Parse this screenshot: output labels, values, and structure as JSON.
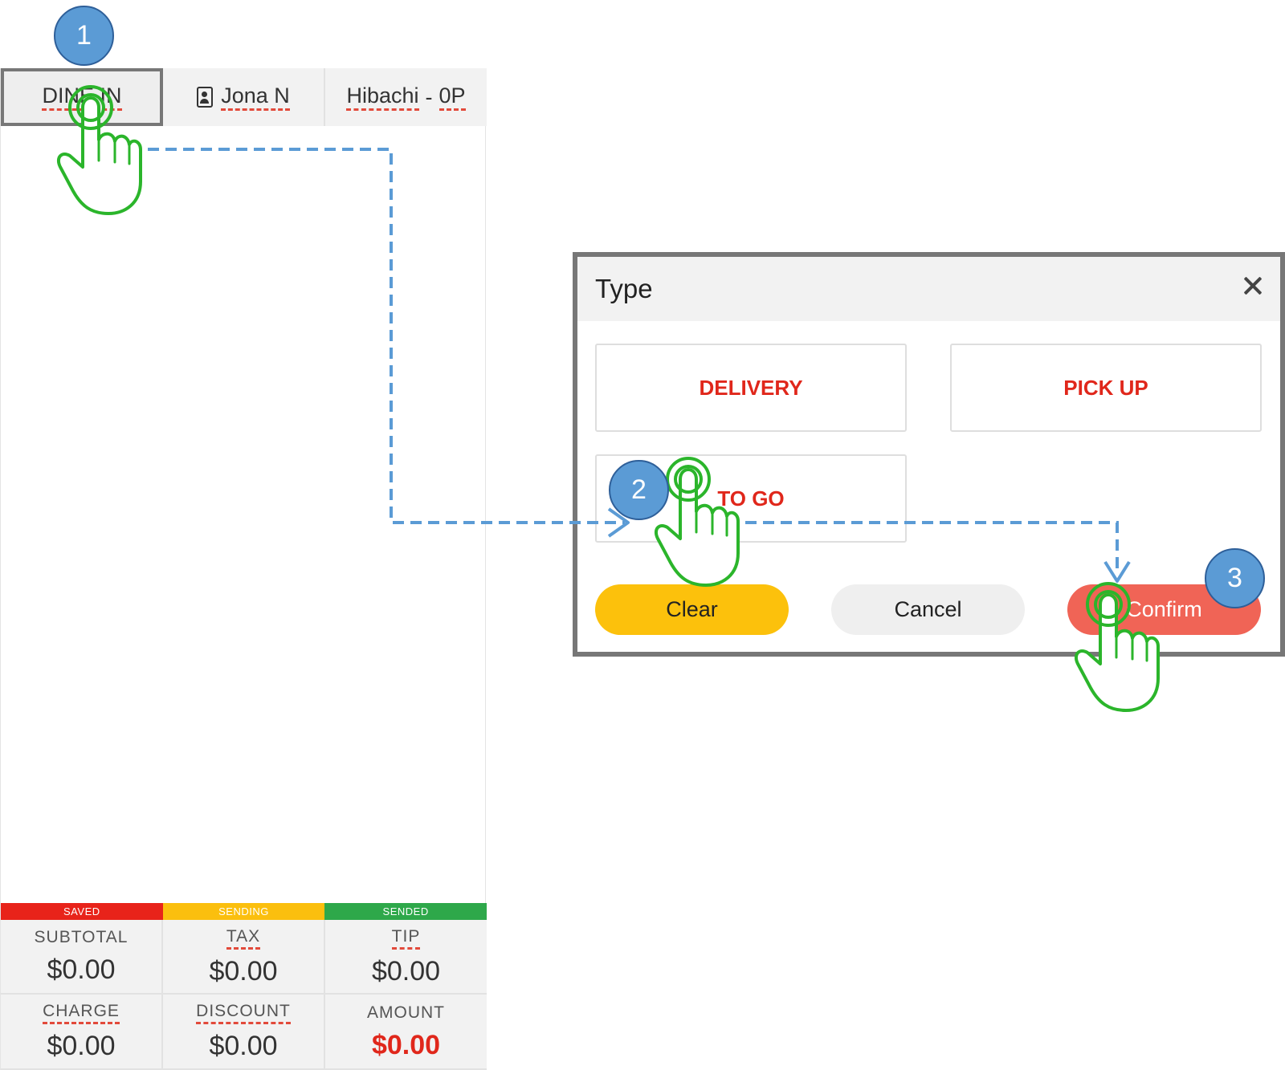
{
  "pos": {
    "tabs": {
      "order_type": "DINE IN",
      "customer": "Jona N",
      "table_name": "Hibachi",
      "separator": "-",
      "party": "0P"
    },
    "status": [
      {
        "label": "SAVED",
        "color": "#e8231a"
      },
      {
        "label": "SENDING",
        "color": "#fbbf0e"
      },
      {
        "label": "SENDED",
        "color": "#2ea84a"
      }
    ],
    "totals": {
      "subtotal": {
        "label": "SUBTOTAL",
        "value": "$0.00"
      },
      "tax": {
        "label": "TAX",
        "value": "$0.00"
      },
      "tip": {
        "label": "TIP",
        "value": "$0.00"
      },
      "charge": {
        "label": "CHARGE",
        "value": "$0.00"
      },
      "discount": {
        "label": "DISCOUNT",
        "value": "$0.00"
      },
      "amount": {
        "label": "AMOUNT",
        "value": "$0.00"
      }
    }
  },
  "dialog": {
    "title": "Type",
    "options": {
      "delivery": "DELIVERY",
      "pickup": "PICK UP",
      "togo": "TO GO"
    },
    "buttons": {
      "clear": "Clear",
      "cancel": "Cancel",
      "confirm": "Confirm"
    }
  },
  "annotations": {
    "steps": [
      "1",
      "2",
      "3"
    ],
    "icons": [
      "tap-hand-icon",
      "dashed-arrow-icon"
    ],
    "colors": {
      "badge": "#5b9bd5",
      "arrow": "#5b9bd5",
      "hand_outline": "#2bb52b",
      "option_text": "#e0271b",
      "clear": "#fcc10c",
      "confirm": "#f06456"
    }
  }
}
